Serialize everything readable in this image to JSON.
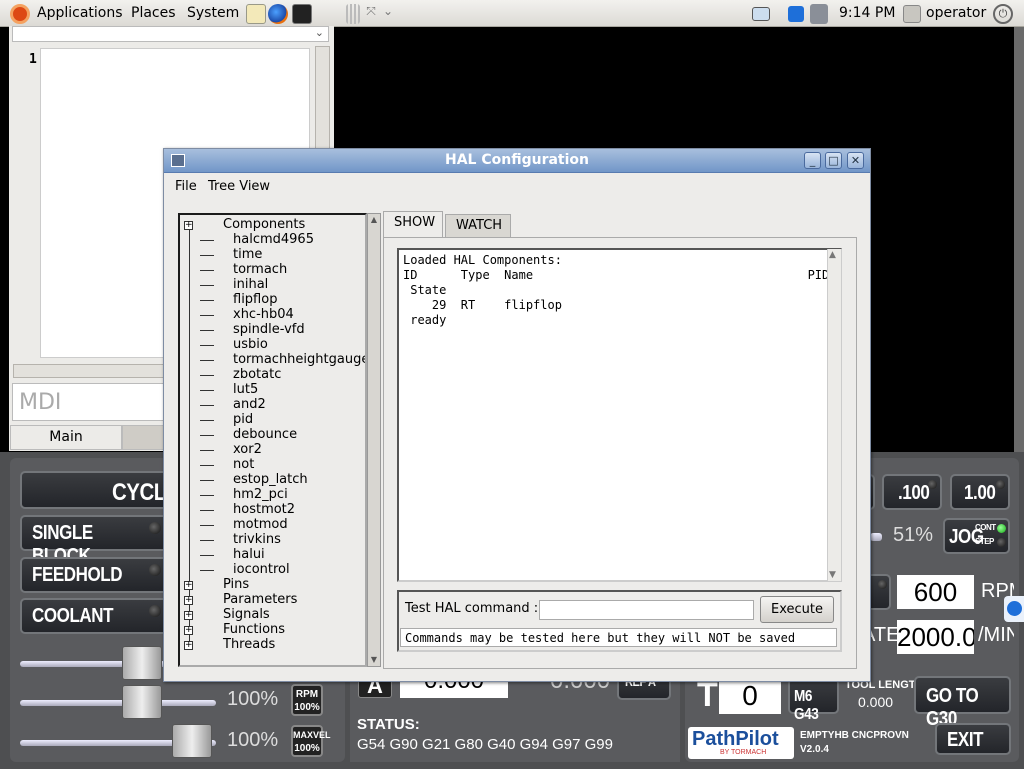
{
  "top_panel": {
    "menus": [
      "Applications",
      "Places",
      "System"
    ],
    "clock": "9:14 PM",
    "user": "operator"
  },
  "editor": {
    "line_number": "1",
    "mdi_placeholder": "MDI",
    "tab_main": "Main"
  },
  "hal": {
    "title": "HAL Configuration",
    "menu": [
      "File",
      "Tree View"
    ],
    "tree": {
      "root": "Components",
      "components": [
        "halcmd4965",
        "time",
        "tormach",
        "inihal",
        "flipflop",
        "xhc-hb04",
        "spindle-vfd",
        "usbio",
        "tormachheightgauge",
        "zbotatc",
        "lut5",
        "and2",
        "pid",
        "debounce",
        "xor2",
        "not",
        "estop_latch",
        "hm2_pci",
        "hostmot2",
        "motmod",
        "trivkins",
        "halui",
        "iocontrol"
      ],
      "others": [
        "Pins",
        "Parameters",
        "Signals",
        "Functions",
        "Threads"
      ]
    },
    "tabs": [
      "SHOW",
      "WATCH"
    ],
    "output_lines": [
      "Loaded HAL Components:",
      "ID      Type  Name                                      PID",
      " State",
      "    29  RT    flipflop",
      " ready"
    ],
    "cmd_label": "Test HAL command :",
    "exec_label": "Execute",
    "cmd_note": "Commands may be tested here but they will NOT be saved"
  },
  "machine": {
    "cycle": "CYCL",
    "single_block": "SINGLE BLOCK",
    "feedhold": "FEEDHOLD",
    "coolant": "COOLANT",
    "rpm_pct": "100%",
    "maxvel_pct": "100%",
    "rpm_badge": [
      "RPM",
      "100%"
    ],
    "maxvel_badge": [
      "MAXVEL",
      "100%"
    ],
    "jog_100": ".100",
    "jog_1000": "1.00",
    "jog_pct": "51%",
    "jog_btn": "JOG",
    "jog_cont": "CONT",
    "jog_step": "STEP",
    "rpm_value": "600",
    "rpm_unit": "RPM",
    "feed_label": "ATE:",
    "feed_value": "2000.0",
    "feed_unit": "/MIN",
    "a_label": "A",
    "a_value": "0.000",
    "a_value2": "0.000",
    "ref_a": "REF A",
    "status_label": "STATUS:",
    "status_codes": "G54 G90 G21 G80 G40 G94 G97 G99",
    "tool_label": "T",
    "tool_value": "0",
    "m6g43": "M6 G43",
    "tool_length_label": "TOOL LENGTH",
    "tool_length_value": "0.000",
    "goto_g30": "GO TO G30",
    "exit": "EXIT",
    "logo": "PathPilot",
    "logo_sub": "BY TORMACH",
    "profile": "EMPTYHB CNCPROVN",
    "version": "V2.0.4"
  }
}
